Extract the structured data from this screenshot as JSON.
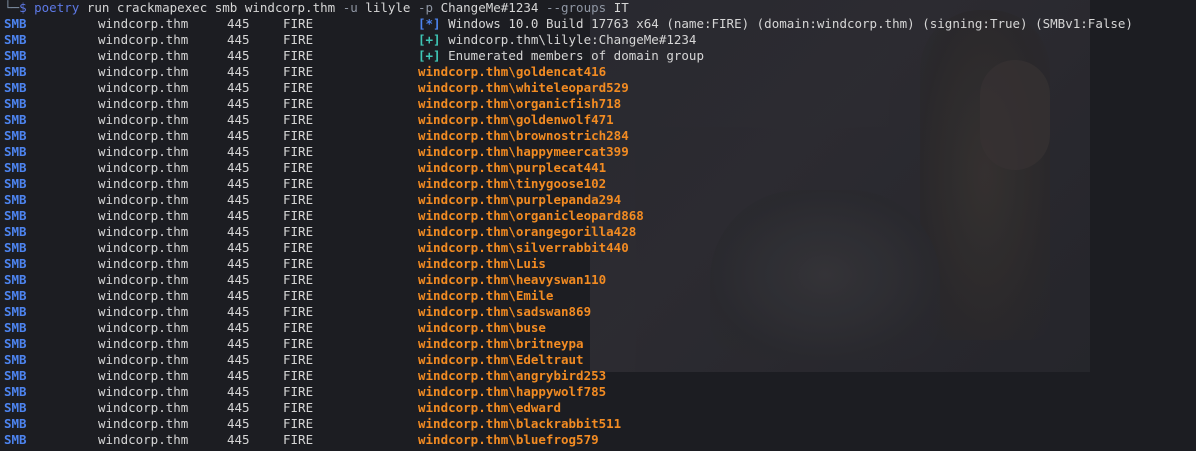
{
  "command": {
    "corner": "└─",
    "dollar": "$",
    "program": "poetry",
    "arg1": "run crackmapexec smb windcorp.thm",
    "flag_u": "-u",
    "user": "lilyle",
    "flag_p": "-p",
    "password": "ChangeMe#1234",
    "flag_groups": "--groups",
    "group": "IT"
  },
  "status_rows": [
    {
      "proto": "SMB",
      "host": "windcorp.thm",
      "port": "445",
      "name": "FIRE",
      "marker": "[*]",
      "text": "Windows 10.0 Build 17763 x64 (name:FIRE) (domain:windcorp.thm) (signing:True) (SMBv1:False)"
    },
    {
      "proto": "SMB",
      "host": "windcorp.thm",
      "port": "445",
      "name": "FIRE",
      "marker": "[+]",
      "text": "windcorp.thm\\lilyle:ChangeMe#1234"
    },
    {
      "proto": "SMB",
      "host": "windcorp.thm",
      "port": "445",
      "name": "FIRE",
      "marker": "[+]",
      "text": "Enumerated members of domain group"
    }
  ],
  "member_rows": [
    {
      "proto": "SMB",
      "host": "windcorp.thm",
      "port": "445",
      "name": "FIRE",
      "member": "windcorp.thm\\goldencat416"
    },
    {
      "proto": "SMB",
      "host": "windcorp.thm",
      "port": "445",
      "name": "FIRE",
      "member": "windcorp.thm\\whiteleopard529"
    },
    {
      "proto": "SMB",
      "host": "windcorp.thm",
      "port": "445",
      "name": "FIRE",
      "member": "windcorp.thm\\organicfish718"
    },
    {
      "proto": "SMB",
      "host": "windcorp.thm",
      "port": "445",
      "name": "FIRE",
      "member": "windcorp.thm\\goldenwolf471"
    },
    {
      "proto": "SMB",
      "host": "windcorp.thm",
      "port": "445",
      "name": "FIRE",
      "member": "windcorp.thm\\brownostrich284"
    },
    {
      "proto": "SMB",
      "host": "windcorp.thm",
      "port": "445",
      "name": "FIRE",
      "member": "windcorp.thm\\happymeercat399"
    },
    {
      "proto": "SMB",
      "host": "windcorp.thm",
      "port": "445",
      "name": "FIRE",
      "member": "windcorp.thm\\purplecat441"
    },
    {
      "proto": "SMB",
      "host": "windcorp.thm",
      "port": "445",
      "name": "FIRE",
      "member": "windcorp.thm\\tinygoose102"
    },
    {
      "proto": "SMB",
      "host": "windcorp.thm",
      "port": "445",
      "name": "FIRE",
      "member": "windcorp.thm\\purplepanda294"
    },
    {
      "proto": "SMB",
      "host": "windcorp.thm",
      "port": "445",
      "name": "FIRE",
      "member": "windcorp.thm\\organicleopard868"
    },
    {
      "proto": "SMB",
      "host": "windcorp.thm",
      "port": "445",
      "name": "FIRE",
      "member": "windcorp.thm\\orangegorilla428"
    },
    {
      "proto": "SMB",
      "host": "windcorp.thm",
      "port": "445",
      "name": "FIRE",
      "member": "windcorp.thm\\silverrabbit440"
    },
    {
      "proto": "SMB",
      "host": "windcorp.thm",
      "port": "445",
      "name": "FIRE",
      "member": "windcorp.thm\\Luis"
    },
    {
      "proto": "SMB",
      "host": "windcorp.thm",
      "port": "445",
      "name": "FIRE",
      "member": "windcorp.thm\\heavyswan110"
    },
    {
      "proto": "SMB",
      "host": "windcorp.thm",
      "port": "445",
      "name": "FIRE",
      "member": "windcorp.thm\\Emile"
    },
    {
      "proto": "SMB",
      "host": "windcorp.thm",
      "port": "445",
      "name": "FIRE",
      "member": "windcorp.thm\\sadswan869"
    },
    {
      "proto": "SMB",
      "host": "windcorp.thm",
      "port": "445",
      "name": "FIRE",
      "member": "windcorp.thm\\buse"
    },
    {
      "proto": "SMB",
      "host": "windcorp.thm",
      "port": "445",
      "name": "FIRE",
      "member": "windcorp.thm\\britneypa"
    },
    {
      "proto": "SMB",
      "host": "windcorp.thm",
      "port": "445",
      "name": "FIRE",
      "member": "windcorp.thm\\Edeltraut"
    },
    {
      "proto": "SMB",
      "host": "windcorp.thm",
      "port": "445",
      "name": "FIRE",
      "member": "windcorp.thm\\angrybird253"
    },
    {
      "proto": "SMB",
      "host": "windcorp.thm",
      "port": "445",
      "name": "FIRE",
      "member": "windcorp.thm\\happywolf785"
    },
    {
      "proto": "SMB",
      "host": "windcorp.thm",
      "port": "445",
      "name": "FIRE",
      "member": "windcorp.thm\\edward"
    },
    {
      "proto": "SMB",
      "host": "windcorp.thm",
      "port": "445",
      "name": "FIRE",
      "member": "windcorp.thm\\blackrabbit511"
    },
    {
      "proto": "SMB",
      "host": "windcorp.thm",
      "port": "445",
      "name": "FIRE",
      "member": "windcorp.thm\\bluefrog579"
    }
  ],
  "colors": {
    "background": "#1c1d22",
    "proto": "#4d84f0",
    "marker_info": "#4d84f0",
    "marker_ok": "#3fc7b7",
    "member": "#f28b22",
    "text": "#d6d6d6"
  }
}
